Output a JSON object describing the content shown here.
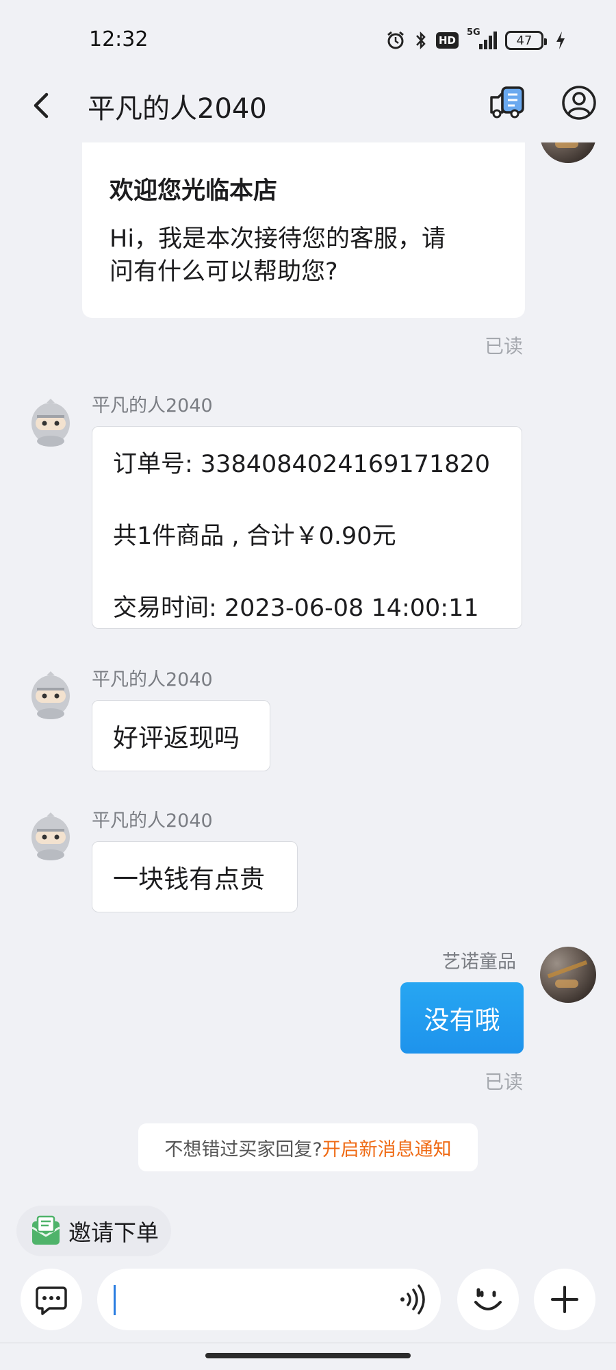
{
  "status_bar": {
    "time": "12:32",
    "network": "5G",
    "hd": "HD",
    "battery": "47",
    "icons": [
      "alarm-icon",
      "bluetooth-icon",
      "hd-icon",
      "signal-icon",
      "battery-icon",
      "charging-icon"
    ]
  },
  "header": {
    "title": "平凡的人2040",
    "icons": [
      "back-arrow-icon",
      "order-truck-icon",
      "user-profile-icon"
    ]
  },
  "messages": {
    "welcome": {
      "title": "欢迎您光临本店",
      "body_line1": "Hi，我是本次接待您的客服，请",
      "body_line2": "问有什么可以帮助您?",
      "status": "已读"
    },
    "order_card": {
      "sender": "平凡的人2040",
      "order_no": "订单号: 3384084024169171820",
      "summary": "共1件商品 , 合计￥0.90元",
      "time": "交易时间: 2023-06-08 14:00:11"
    },
    "buyer_msg_1": {
      "sender": "平凡的人2040",
      "text": "好评返现吗"
    },
    "buyer_msg_2": {
      "sender": "平凡的人2040",
      "text": "一块钱有点贵"
    },
    "seller_msg": {
      "sender": "艺诺童品",
      "text": "没有哦",
      "status": "已读"
    }
  },
  "notice": {
    "text": "不想错过买家回复?",
    "link": "开启新消息通知"
  },
  "invite": {
    "label": "邀请下单"
  },
  "input_bar": {
    "placeholder": "",
    "value": "",
    "icons": [
      "quick-reply-icon",
      "voice-icon",
      "emoji-icon",
      "plus-icon"
    ]
  },
  "colors": {
    "background": "#f0f1f5",
    "accent_blue": "#1e93ec",
    "link_orange": "#ef6a14",
    "read_gray": "#a5a8ae"
  }
}
